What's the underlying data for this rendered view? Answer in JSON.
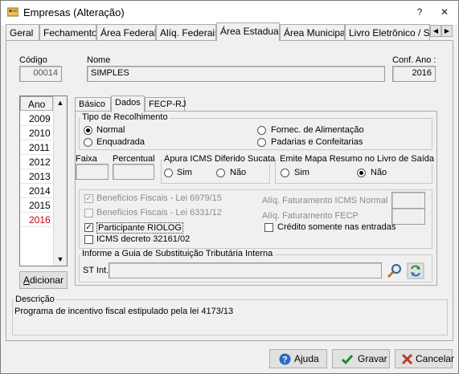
{
  "window": {
    "title": "Empresas (Alteração)"
  },
  "titlebar_buttons": [
    "?",
    "✕"
  ],
  "tabs": [
    {
      "label": "Geral"
    },
    {
      "label": "Fechamento"
    },
    {
      "label": "Área Federal"
    },
    {
      "label": "Alíq. Federais"
    },
    {
      "label": "Área Estadual"
    },
    {
      "label": "Área Municipal"
    },
    {
      "label": "Livro Eletrônico / SF"
    }
  ],
  "tab_scroll": {
    "left": "◀",
    "right": "▶"
  },
  "header": {
    "codigo_label": "Código",
    "codigo_value": "00014",
    "nome_label": "Nome",
    "nome_value": "SIMPLES",
    "conf_ano_label": "Conf. Ano :",
    "conf_ano_value": "2016"
  },
  "year_list": {
    "header": "Ano",
    "items": [
      "2009",
      "2010",
      "2011",
      "2012",
      "2013",
      "2014",
      "2015",
      "2016"
    ],
    "selected": "2016",
    "scroll_up": "▲",
    "scroll_down": "▼"
  },
  "adicionar_button": "Adicionar",
  "subtabs": [
    {
      "label": "Básico"
    },
    {
      "label": "Dados"
    },
    {
      "label": "FECP-RJ"
    }
  ],
  "tipo_recolhimento": {
    "title": "Tipo de Recolhimento",
    "options": [
      {
        "label": "Normal",
        "selected": true
      },
      {
        "label": "Enquadrada",
        "selected": false
      },
      {
        "label": "Fornec. de Alimentação",
        "selected": false
      },
      {
        "label": "Padarias e Confeitarias",
        "selected": false
      }
    ]
  },
  "faixa_label": "Faixa",
  "percentual_label": "Percentual",
  "apura_icms": {
    "title": "Apura ICMS Diferido Sucata",
    "sim": "Sim",
    "nao": "Não",
    "selected": "none"
  },
  "emite_mapa": {
    "title": "Emite Mapa Resumo no Livro de Saída",
    "sim": "Sim",
    "nao": "Não",
    "selected": "Não"
  },
  "checkboxes": [
    {
      "label": "Benefícios Fiscais - Lei 6979/15",
      "checked": true,
      "disabled": true
    },
    {
      "label": "Benefícios Fiscais - Lei 6331/12",
      "checked": false,
      "disabled": true
    },
    {
      "label": "Participante RIOLOG",
      "checked": true,
      "disabled": false
    },
    {
      "label": "ICMS decreto 32161/02",
      "checked": false,
      "disabled": false
    }
  ],
  "aliq_icms_normal_label": "Alíq. Faturamento ICMS Normal",
  "aliq_fecp_label": "Alíq. Faturamento FECP",
  "credito_label": "Crédito somente nas entradas",
  "guia_st": {
    "title": "Informe a Guia de Substituição Tributária Interna",
    "st_int_label": "ST Int.",
    "value": ""
  },
  "descricao": {
    "title": "Descrição",
    "text": "Programa de incentivo fiscal estipulado pela lei 4173/13"
  },
  "footer": {
    "ajuda": "Ajuda",
    "gravar": "Gravar",
    "cancelar": "Cancelar"
  },
  "colors": {
    "selected_year": "#cc0000",
    "panel": "#f0f0f0",
    "accent": "#1e5fb4"
  }
}
